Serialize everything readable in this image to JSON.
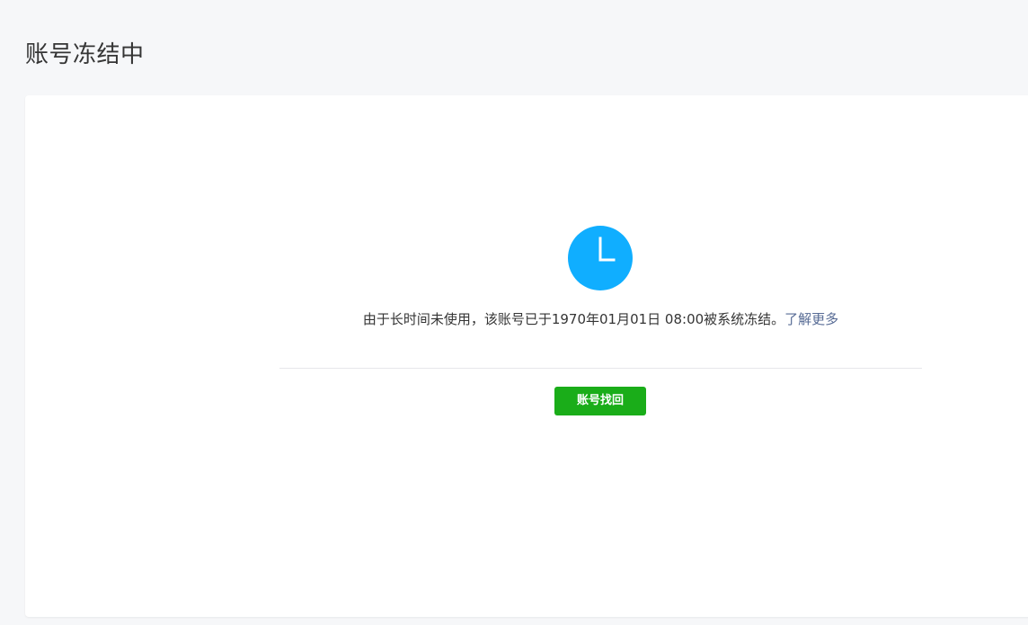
{
  "page": {
    "title": "账号冻结中"
  },
  "notice": {
    "icon": "clock-icon",
    "icon_color": "#10aeff",
    "message": "由于长时间未使用，该账号已于1970年01月01日 08:00被系统冻结。",
    "learn_more_label": "了解更多",
    "learn_more_color": "#576b95"
  },
  "actions": {
    "recover_label": "账号找回",
    "recover_color": "#1aad19"
  }
}
